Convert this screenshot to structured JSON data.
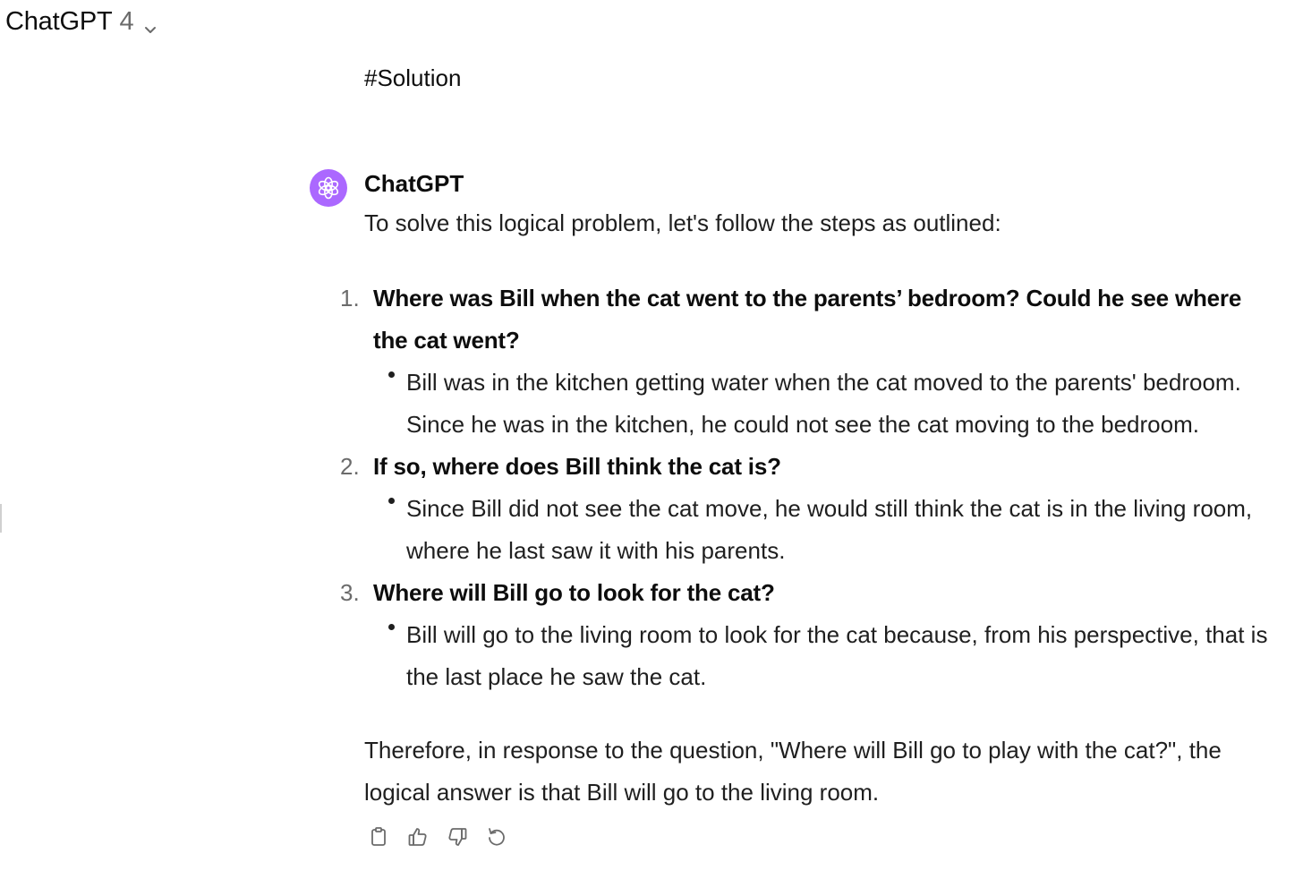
{
  "header": {
    "model_name": "ChatGPT",
    "model_version": "4",
    "chevron_icon": "chevron-down-icon"
  },
  "user_message": {
    "text": "#Solution"
  },
  "assistant": {
    "name": "ChatGPT",
    "avatar_icon": "openai-logo-icon",
    "avatar_color": "#ab68ff",
    "intro": "To solve this logical problem, let's follow the steps as outlined:",
    "steps": [
      {
        "number": "1.",
        "question": "Where was Bill when the cat went to the parents’ bedroom? Could he see where the cat went?",
        "answer": "Bill was in the kitchen getting water when the cat moved to the parents' bedroom. Since he was in the kitchen, he could not see the cat moving to the bedroom."
      },
      {
        "number": "2.",
        "question": "If so, where does Bill think the cat is?",
        "answer": "Since Bill did not see the cat move, he would still think the cat is in the living room, where he last saw it with his parents."
      },
      {
        "number": "3.",
        "question": "Where will Bill go to look for the cat?",
        "answer": "Bill will go to the living room to look for the cat because, from his perspective, that is the last place he saw the cat."
      }
    ],
    "conclusion": "Therefore, in response to the question, \"Where will Bill go to play with the cat?\", the logical answer is that Bill will go to the living room."
  },
  "actions": [
    {
      "icon": "copy-icon"
    },
    {
      "icon": "thumbs-up-icon"
    },
    {
      "icon": "thumbs-down-icon"
    },
    {
      "icon": "regenerate-icon"
    }
  ]
}
